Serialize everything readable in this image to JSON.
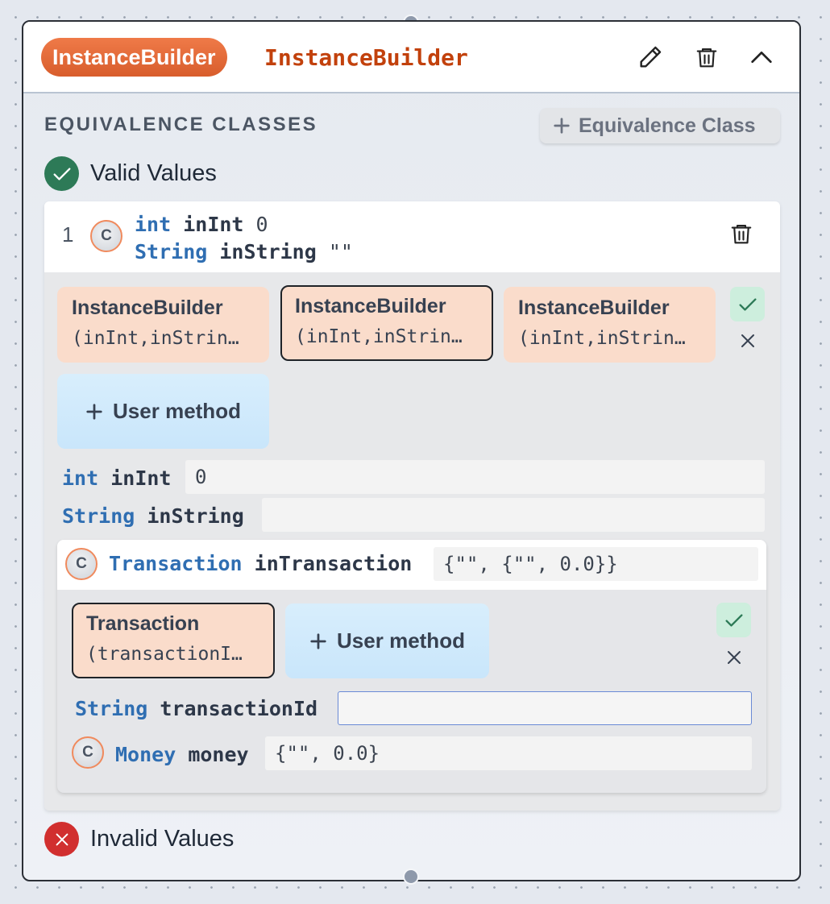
{
  "node": {
    "badge_label": "InstanceBuilder",
    "title": "InstanceBuilder",
    "icons": {
      "edit": "pencil-icon",
      "delete": "trash-icon",
      "collapse": "chevron-up-icon"
    }
  },
  "section": {
    "title": "EQUIVALENCE CLASSES",
    "add_button_label": "Equivalence Class",
    "add_button_icon": "plus-icon"
  },
  "valid": {
    "label": "Valid Values",
    "icon": "check-circle-icon",
    "color": "#2d7a57"
  },
  "invalid": {
    "label": "Invalid Values",
    "icon": "x-circle-icon",
    "color": "#d12f2f"
  },
  "card": {
    "index": "1",
    "class_letter": "C",
    "param1": {
      "type": "int",
      "name": "inInt",
      "value": "0"
    },
    "param2": {
      "type": "String",
      "name": "inString",
      "value": "\"\""
    },
    "chips": [
      {
        "title": "InstanceBuilder",
        "args": "(inInt,inStrin…",
        "selected": false
      },
      {
        "title": "InstanceBuilder",
        "args": "(inInt,inStrin…",
        "selected": true
      },
      {
        "title": "InstanceBuilder",
        "args": "(inInt,inStrin…",
        "selected": false
      }
    ],
    "user_method_label": "User method",
    "fields": [
      {
        "type": "int",
        "name": "inInt",
        "value": "0"
      },
      {
        "type": "String",
        "name": "inString",
        "value": ""
      }
    ],
    "nested": {
      "class_letter": "C",
      "type": "Transaction",
      "name": "inTransaction",
      "value": "{\"\", {\"\", 0.0}}",
      "chip": {
        "title": "Transaction",
        "args": "(transactionI…"
      },
      "user_method_label": "User method",
      "field": {
        "type": "String",
        "name": "transactionId",
        "value": ""
      },
      "money": {
        "class_letter": "C",
        "type": "Money",
        "name": "money",
        "value": "{\"\", 0.0}"
      }
    }
  },
  "colors": {
    "accent": "#c2410c",
    "badge": "#e8693a",
    "type_keyword": "#2f6eb2"
  }
}
